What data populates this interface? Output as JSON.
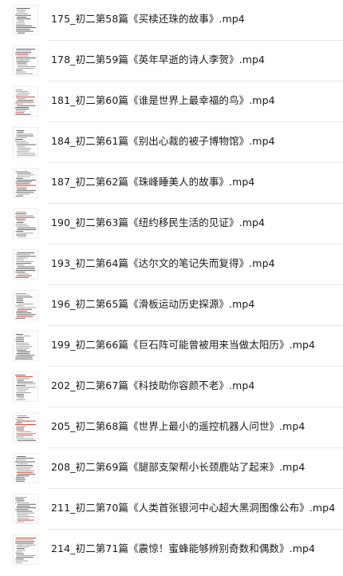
{
  "files": [
    {
      "name": "175_初二第58篇《买椟还珠的故事》.mp4",
      "icon": "video-thumbnail-icon"
    },
    {
      "name": "178_初二第59篇《英年早逝的诗人李贺》.mp4",
      "icon": "video-thumbnail-icon"
    },
    {
      "name": "181_初二第60篇《谁是世界上最幸福的鸟》.mp4",
      "icon": "video-thumbnail-icon"
    },
    {
      "name": "184_初二第61篇《别出心裁的被子博物馆》.mp4",
      "icon": "video-thumbnail-icon"
    },
    {
      "name": "187_初二第62篇《珠峰睡美人的故事》.mp4",
      "icon": "video-thumbnail-icon"
    },
    {
      "name": "190_初二第63篇《纽约移民生活的见证》.mp4",
      "icon": "video-thumbnail-icon"
    },
    {
      "name": "193_初二第64篇《达尔文的笔记失而复得》.mp4",
      "icon": "video-thumbnail-icon"
    },
    {
      "name": "196_初二第65篇《滑板运动历史探源》.mp4",
      "icon": "video-thumbnail-icon"
    },
    {
      "name": "199_初二第66篇《巨石阵可能曾被用来当做太阳历》.mp4",
      "icon": "video-thumbnail-icon"
    },
    {
      "name": "202_初二第67篇《科技助你容颜不老》.mp4",
      "icon": "video-thumbnail-icon"
    },
    {
      "name": "205_初二第68篇《世界上最小的遥控机器人问世》.mp4",
      "icon": "video-thumbnail-icon"
    },
    {
      "name": "208_初二第69篇《腿部支架帮小长颈鹿站了起来》.mp4",
      "icon": "video-thumbnail-icon"
    },
    {
      "name": "211_初二第70篇《人类首张银河中心超大黑洞图像公布》.mp4",
      "icon": "video-thumbnail-icon"
    },
    {
      "name": "214_初二第71篇《震惊！蜜蜂能够辨别奇数和偶数》.mp4",
      "icon": "video-thumbnail-icon"
    }
  ]
}
